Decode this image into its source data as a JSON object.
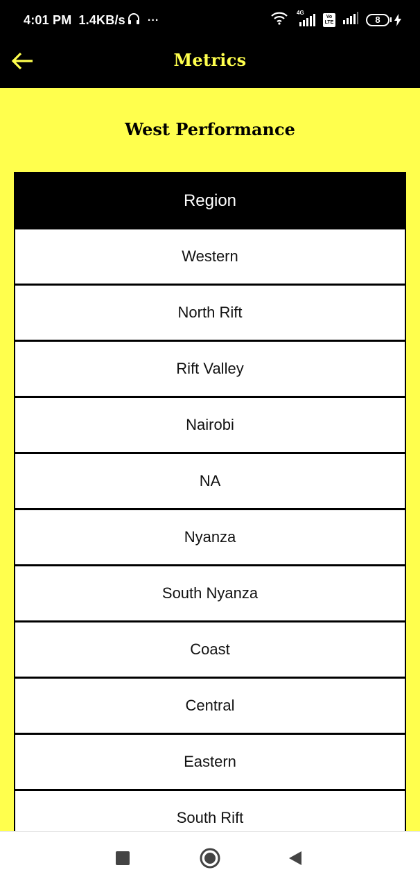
{
  "status_bar": {
    "time": "4:01 PM",
    "speed": "1.4KB/s",
    "more": "···",
    "signal_label": "4G",
    "volte_label": "Vo LTE",
    "battery": "8"
  },
  "app_bar": {
    "title": "Metrics",
    "back_icon": "arrow-left-icon"
  },
  "section": {
    "title": "West Performance"
  },
  "table": {
    "header": "Region",
    "rows": [
      "Western",
      "North Rift",
      "Rift Valley",
      "Nairobi",
      "NA",
      "Nyanza",
      "South Nyanza",
      "Coast",
      "Central",
      "Eastern",
      "South Rift"
    ]
  },
  "nav": {
    "recents_icon": "square-icon",
    "home_icon": "circle-icon",
    "back_icon": "triangle-back-icon"
  },
  "colors": {
    "background": "#ffff4d",
    "bar": "#000000",
    "accent_title": "#ffff4d"
  }
}
